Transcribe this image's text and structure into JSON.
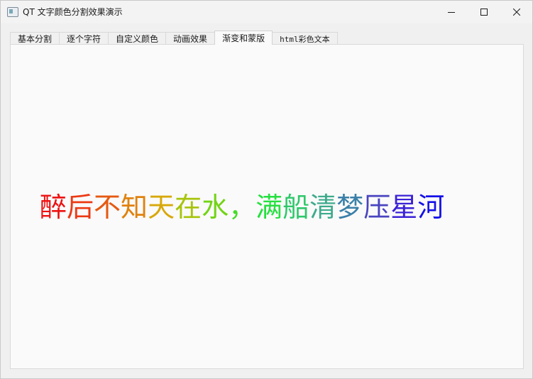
{
  "window": {
    "title": "QT 文字颜色分割效果演示",
    "icon": "app-window-icon",
    "controls": [
      {
        "name": "minimize-button",
        "icon": "minimize-icon"
      },
      {
        "name": "maximize-button",
        "icon": "maximize-icon"
      },
      {
        "name": "close-button",
        "icon": "close-icon"
      }
    ]
  },
  "tabs": [
    {
      "label": "基本分割",
      "active": false
    },
    {
      "label": "逐个字符",
      "active": false
    },
    {
      "label": "自定义颜色",
      "active": false
    },
    {
      "label": "动画效果",
      "active": false
    },
    {
      "label": "渐变和蒙版",
      "active": true
    },
    {
      "label": "html彩色文本",
      "active": false
    }
  ],
  "poem": {
    "chars": [
      {
        "ch": "醉",
        "color": "#ee1111"
      },
      {
        "ch": "后",
        "color": "#ec3a14"
      },
      {
        "ch": "不",
        "color": "#e65a10"
      },
      {
        "ch": "知",
        "color": "#e0820e"
      },
      {
        "ch": "天",
        "color": "#d8a80a"
      },
      {
        "ch": "在",
        "color": "#a8c40a"
      },
      {
        "ch": "水",
        "color": "#72d414"
      },
      {
        "ch": "，",
        "color": "#46dc28"
      },
      {
        "ch": "满",
        "color": "#26e040"
      },
      {
        "ch": "船",
        "color": "#2ec86a"
      },
      {
        "ch": "清",
        "color": "#3eaa8c"
      },
      {
        "ch": "梦",
        "color": "#3a80a8"
      },
      {
        "ch": "压",
        "color": "#4a44c0"
      },
      {
        "ch": "星",
        "color": "#3a22d6"
      },
      {
        "ch": "河",
        "color": "#1410e8"
      }
    ]
  }
}
